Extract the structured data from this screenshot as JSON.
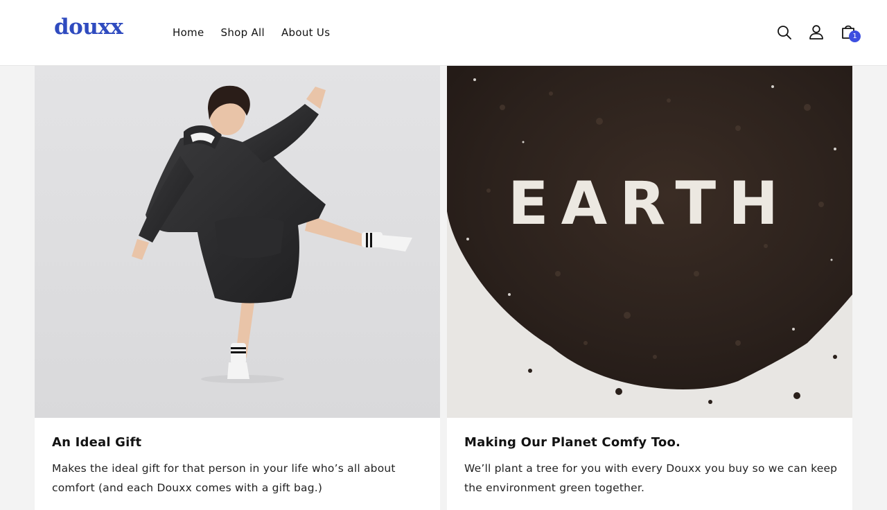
{
  "brand": {
    "logo_text": "douxx",
    "accent_color": "#2f4bbf",
    "badge_color": "#3d4fe0"
  },
  "nav": {
    "items": [
      {
        "label": "Home"
      },
      {
        "label": "Shop All"
      },
      {
        "label": "About Us"
      }
    ]
  },
  "header_icons": {
    "search": "search-icon",
    "account": "account-icon",
    "cart": "cart-icon",
    "cart_count": "1"
  },
  "cards": [
    {
      "image": "kid-in-oversized-hoodie-photo",
      "title": "An Ideal Gift",
      "text": "Makes the ideal gift for that person in your life who’s all about comfort (and each Douxx comes with a gift bag.)"
    },
    {
      "image": "earth-written-in-soil-photo",
      "image_text": "EARTH",
      "title": "Making Our Planet Comfy Too.",
      "text": "We’ll plant a tree for you with every Douxx you buy so we can keep the environment green together."
    }
  ]
}
